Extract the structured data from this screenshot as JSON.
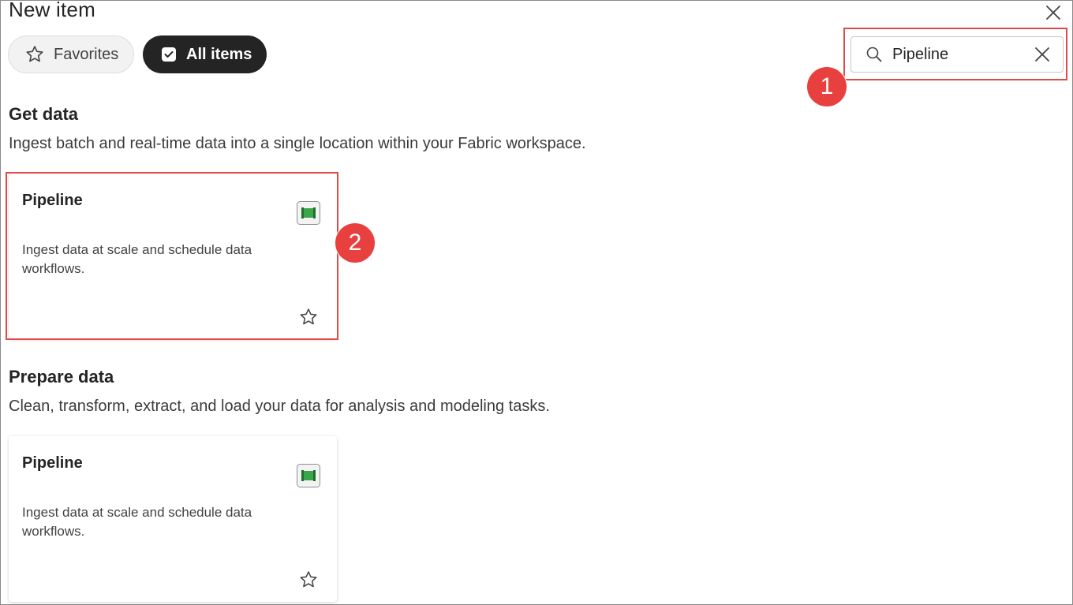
{
  "dialog": {
    "title": "New item",
    "close_icon": "close-icon"
  },
  "filters": {
    "favorites_label": "Favorites",
    "all_items_label": "All items",
    "selected": "All items"
  },
  "search": {
    "value": "Pipeline",
    "icon": "search-icon",
    "clear_icon": "clear-icon"
  },
  "annotations": {
    "badge_1": "1",
    "badge_2": "2",
    "color": "#e04a4a"
  },
  "sections": [
    {
      "title": "Get data",
      "description": "Ingest batch and real-time data into a single location within your Fabric workspace.",
      "card": {
        "title": "Pipeline",
        "description": "Ingest data at scale and schedule data workflows.",
        "icon": "pipeline-icon",
        "favorite_icon": "star-icon"
      }
    },
    {
      "title": "Prepare data",
      "description": "Clean, transform, extract, and load your data for analysis and modeling tasks.",
      "card": {
        "title": "Pipeline",
        "description": "Ingest data at scale and schedule data workflows.",
        "icon": "pipeline-icon",
        "favorite_icon": "star-icon"
      }
    }
  ],
  "colors": {
    "selected_pill": "#242424",
    "pipeline_icon": "#2e8b3e"
  }
}
